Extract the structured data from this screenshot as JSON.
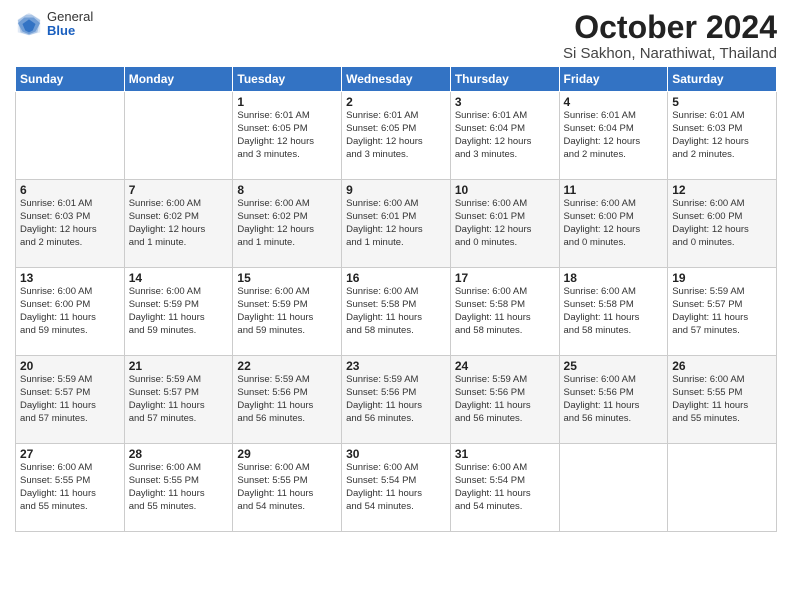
{
  "logo": {
    "general": "General",
    "blue": "Blue"
  },
  "title": "October 2024",
  "location": "Si Sakhon, Narathiwat, Thailand",
  "weekdays": [
    "Sunday",
    "Monday",
    "Tuesday",
    "Wednesday",
    "Thursday",
    "Friday",
    "Saturday"
  ],
  "weeks": [
    [
      {
        "day": "",
        "info": ""
      },
      {
        "day": "",
        "info": ""
      },
      {
        "day": "1",
        "info": "Sunrise: 6:01 AM\nSunset: 6:05 PM\nDaylight: 12 hours\nand 3 minutes."
      },
      {
        "day": "2",
        "info": "Sunrise: 6:01 AM\nSunset: 6:05 PM\nDaylight: 12 hours\nand 3 minutes."
      },
      {
        "day": "3",
        "info": "Sunrise: 6:01 AM\nSunset: 6:04 PM\nDaylight: 12 hours\nand 3 minutes."
      },
      {
        "day": "4",
        "info": "Sunrise: 6:01 AM\nSunset: 6:04 PM\nDaylight: 12 hours\nand 2 minutes."
      },
      {
        "day": "5",
        "info": "Sunrise: 6:01 AM\nSunset: 6:03 PM\nDaylight: 12 hours\nand 2 minutes."
      }
    ],
    [
      {
        "day": "6",
        "info": "Sunrise: 6:01 AM\nSunset: 6:03 PM\nDaylight: 12 hours\nand 2 minutes."
      },
      {
        "day": "7",
        "info": "Sunrise: 6:00 AM\nSunset: 6:02 PM\nDaylight: 12 hours\nand 1 minute."
      },
      {
        "day": "8",
        "info": "Sunrise: 6:00 AM\nSunset: 6:02 PM\nDaylight: 12 hours\nand 1 minute."
      },
      {
        "day": "9",
        "info": "Sunrise: 6:00 AM\nSunset: 6:01 PM\nDaylight: 12 hours\nand 1 minute."
      },
      {
        "day": "10",
        "info": "Sunrise: 6:00 AM\nSunset: 6:01 PM\nDaylight: 12 hours\nand 0 minutes."
      },
      {
        "day": "11",
        "info": "Sunrise: 6:00 AM\nSunset: 6:00 PM\nDaylight: 12 hours\nand 0 minutes."
      },
      {
        "day": "12",
        "info": "Sunrise: 6:00 AM\nSunset: 6:00 PM\nDaylight: 12 hours\nand 0 minutes."
      }
    ],
    [
      {
        "day": "13",
        "info": "Sunrise: 6:00 AM\nSunset: 6:00 PM\nDaylight: 11 hours\nand 59 minutes."
      },
      {
        "day": "14",
        "info": "Sunrise: 6:00 AM\nSunset: 5:59 PM\nDaylight: 11 hours\nand 59 minutes."
      },
      {
        "day": "15",
        "info": "Sunrise: 6:00 AM\nSunset: 5:59 PM\nDaylight: 11 hours\nand 59 minutes."
      },
      {
        "day": "16",
        "info": "Sunrise: 6:00 AM\nSunset: 5:58 PM\nDaylight: 11 hours\nand 58 minutes."
      },
      {
        "day": "17",
        "info": "Sunrise: 6:00 AM\nSunset: 5:58 PM\nDaylight: 11 hours\nand 58 minutes."
      },
      {
        "day": "18",
        "info": "Sunrise: 6:00 AM\nSunset: 5:58 PM\nDaylight: 11 hours\nand 58 minutes."
      },
      {
        "day": "19",
        "info": "Sunrise: 5:59 AM\nSunset: 5:57 PM\nDaylight: 11 hours\nand 57 minutes."
      }
    ],
    [
      {
        "day": "20",
        "info": "Sunrise: 5:59 AM\nSunset: 5:57 PM\nDaylight: 11 hours\nand 57 minutes."
      },
      {
        "day": "21",
        "info": "Sunrise: 5:59 AM\nSunset: 5:57 PM\nDaylight: 11 hours\nand 57 minutes."
      },
      {
        "day": "22",
        "info": "Sunrise: 5:59 AM\nSunset: 5:56 PM\nDaylight: 11 hours\nand 56 minutes."
      },
      {
        "day": "23",
        "info": "Sunrise: 5:59 AM\nSunset: 5:56 PM\nDaylight: 11 hours\nand 56 minutes."
      },
      {
        "day": "24",
        "info": "Sunrise: 5:59 AM\nSunset: 5:56 PM\nDaylight: 11 hours\nand 56 minutes."
      },
      {
        "day": "25",
        "info": "Sunrise: 6:00 AM\nSunset: 5:56 PM\nDaylight: 11 hours\nand 56 minutes."
      },
      {
        "day": "26",
        "info": "Sunrise: 6:00 AM\nSunset: 5:55 PM\nDaylight: 11 hours\nand 55 minutes."
      }
    ],
    [
      {
        "day": "27",
        "info": "Sunrise: 6:00 AM\nSunset: 5:55 PM\nDaylight: 11 hours\nand 55 minutes."
      },
      {
        "day": "28",
        "info": "Sunrise: 6:00 AM\nSunset: 5:55 PM\nDaylight: 11 hours\nand 55 minutes."
      },
      {
        "day": "29",
        "info": "Sunrise: 6:00 AM\nSunset: 5:55 PM\nDaylight: 11 hours\nand 54 minutes."
      },
      {
        "day": "30",
        "info": "Sunrise: 6:00 AM\nSunset: 5:54 PM\nDaylight: 11 hours\nand 54 minutes."
      },
      {
        "day": "31",
        "info": "Sunrise: 6:00 AM\nSunset: 5:54 PM\nDaylight: 11 hours\nand 54 minutes."
      },
      {
        "day": "",
        "info": ""
      },
      {
        "day": "",
        "info": ""
      }
    ]
  ]
}
